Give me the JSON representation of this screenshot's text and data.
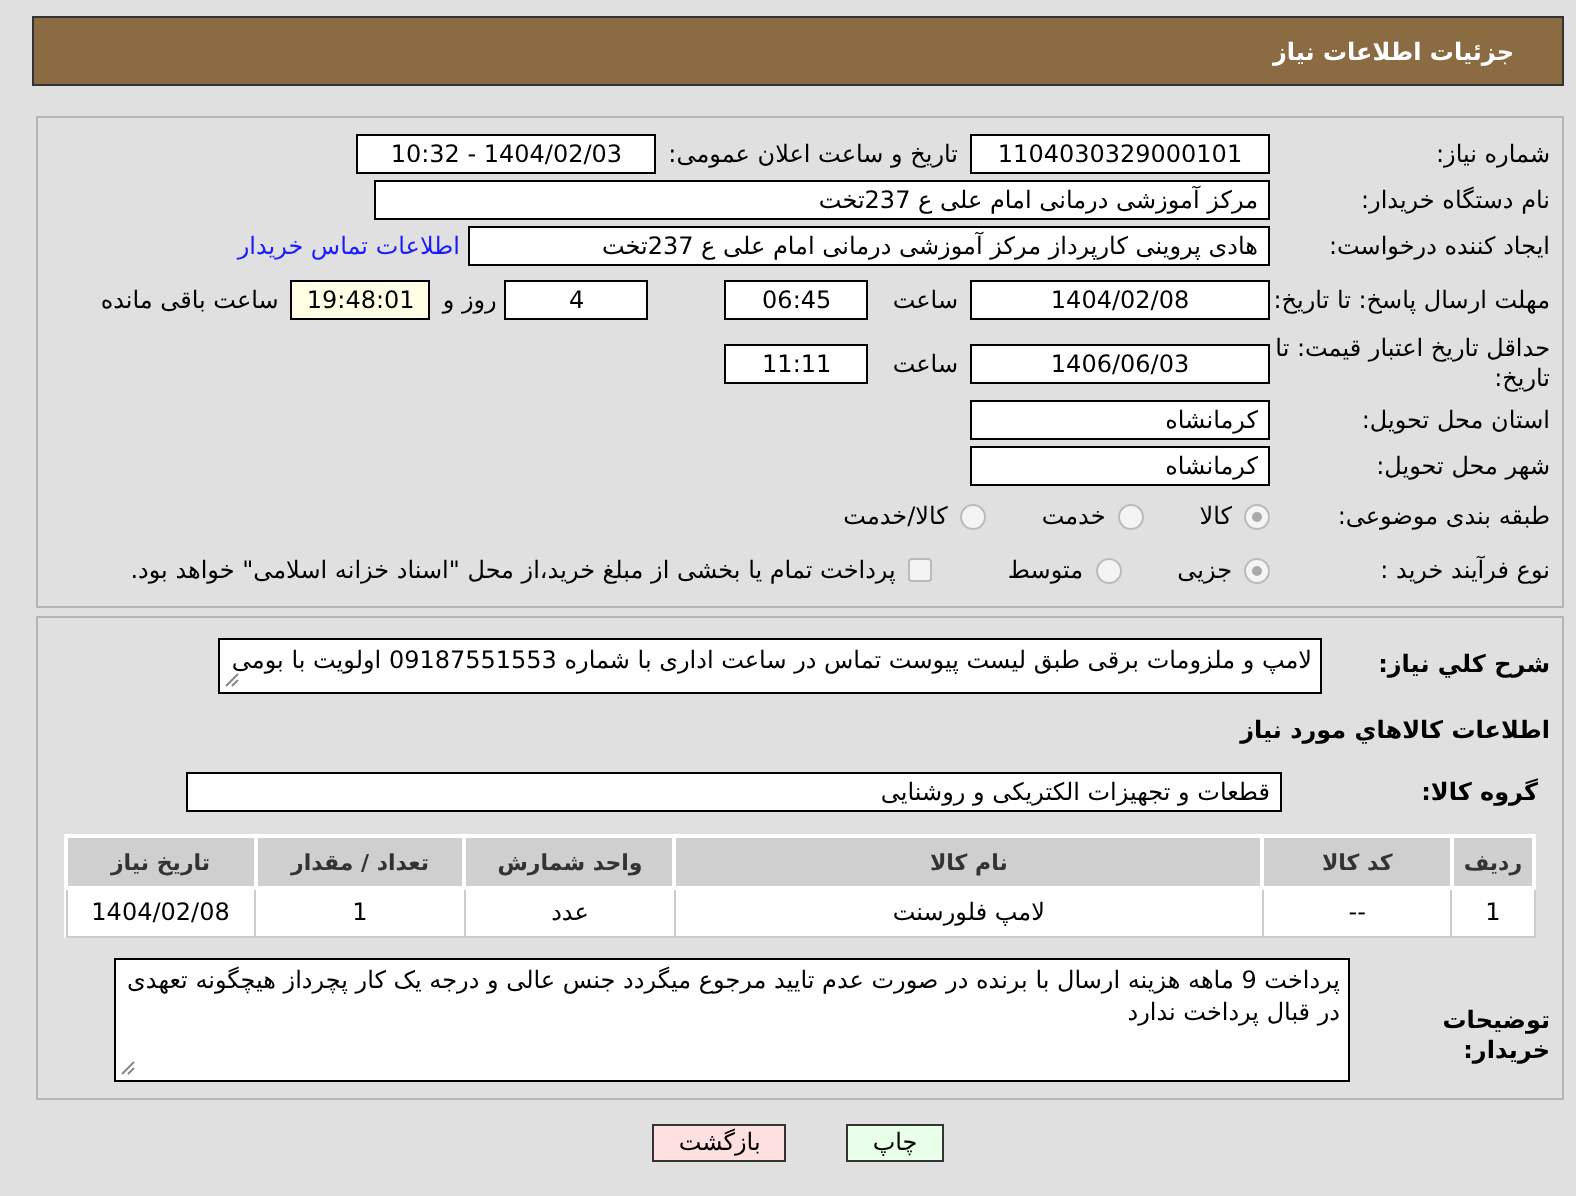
{
  "header": {
    "title": "جزئیات اطلاعات نیاز"
  },
  "need_number": {
    "label": "شماره نیاز:",
    "value": "1104030329000101"
  },
  "announce": {
    "label": "تاریخ و ساعت اعلان عمومی:",
    "value": "1404/02/03 - 10:32"
  },
  "buyer_org": {
    "label": "نام دستگاه خریدار:",
    "value": "مرکز آموزشی درمانی امام علی ع 237تخت"
  },
  "requester": {
    "label": "ایجاد کننده درخواست:",
    "value": "هادی پروینی کارپرداز  مرکز آموزشی درمانی امام علی ع 237تخت",
    "link": "اطلاعات تماس خریدار"
  },
  "deadline": {
    "label": "مهلت ارسال پاسخ: تا تاریخ:",
    "date": "1404/02/08",
    "time_label": "ساعت",
    "time": "06:45",
    "days": "4",
    "days_label": "روز و",
    "remaining": "19:48:01",
    "remaining_label": "ساعت باقی مانده"
  },
  "validity": {
    "label": "حداقل تاریخ اعتبار قیمت: تا تاریخ:",
    "date": "1406/06/03",
    "time_label": "ساعت",
    "time": "11:11"
  },
  "province": {
    "label": "استان محل تحویل:",
    "value": "کرمانشاه"
  },
  "city": {
    "label": "شهر محل تحویل:",
    "value": "کرمانشاه"
  },
  "category": {
    "label": "طبقه بندی موضوعی:",
    "options": [
      {
        "label": "کالا",
        "selected": true
      },
      {
        "label": "خدمت",
        "selected": false
      },
      {
        "label": "کالا/خدمت",
        "selected": false
      }
    ]
  },
  "process": {
    "label": "نوع فرآیند خرید :",
    "options": [
      {
        "label": "جزیی",
        "selected": true
      },
      {
        "label": "متوسط",
        "selected": false
      }
    ],
    "treasury": {
      "checked": false,
      "text": "پرداخت تمام یا بخشی از مبلغ خرید،از محل \"اسناد خزانه اسلامی\" خواهد بود."
    }
  },
  "description": {
    "label": "شرح کلي نياز:",
    "value": "لامپ و ملزومات برقی طبق لیست پیوست  تماس در ساعت اداری با شماره 09187551553  اولویت با بومی"
  },
  "goods_title": "اطلاعات کالاهاي مورد نياز",
  "goods_group": {
    "label": "گروه کالا:",
    "value": "قطعات و تجهیزات الکتریکی و روشنایی"
  },
  "table": {
    "columns": [
      "ردیف",
      "کد کالا",
      "نام کالا",
      "واحد شمارش",
      "تعداد / مقدار",
      "تاریخ نیاز"
    ],
    "rows": [
      [
        "1",
        "--",
        "لامپ فلورسنت",
        "عدد",
        "1",
        "1404/02/08"
      ]
    ]
  },
  "buyer_notes": {
    "label": "توضیحات خریدار:",
    "value": "پرداخت 9 ماهه هزینه ارسال با برنده در صورت عدم تایید مرجوع میگردد جنس عالی و درجه یک  کار پچرداز هیچگونه تعهدی در قبال پرداخت ندارد"
  },
  "buttons": [
    {
      "label": "چاپ",
      "kind": "print"
    },
    {
      "label": "بازگشت",
      "kind": "back"
    }
  ]
}
